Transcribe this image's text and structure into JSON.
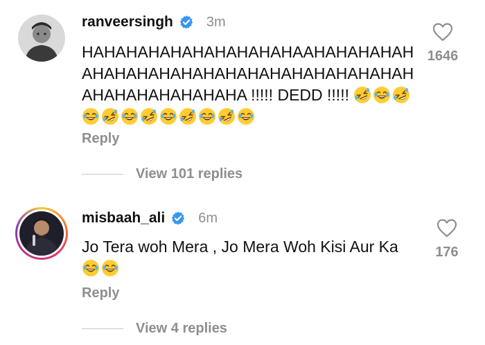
{
  "comments": [
    {
      "username": "ranveersingh",
      "verified": true,
      "time": "3m",
      "text": "HAHAHAHAHAHAHAHAHAHAAHAHAHAHAHAHAHAHAHAHAHAHAHAHAHAHAHAHAHAHAHAHAHAHAHAHAHA !!!!! DEDD !!!!!",
      "emojis": [
        "rolling-laugh",
        "grin-sweat-laugh",
        "rolling-laugh",
        "grin-sweat-laugh",
        "rolling-laugh",
        "grin-sweat-laugh",
        "rolling-laugh",
        "grin-sweat-laugh",
        "rolling-laugh",
        "grin-sweat-laugh",
        "rolling-laugh",
        "grin-sweat-laugh"
      ],
      "reply_label": "Reply",
      "view_replies_label": "View 101 replies",
      "like_count": "1646"
    },
    {
      "username": "misbaah_ali",
      "verified": true,
      "time": "6m",
      "text": "Jo Tera woh Mera , Jo Mera Woh Kisi Aur Ka",
      "emojis": [
        "grin-sweat-laugh",
        "grin-sweat-laugh"
      ],
      "reply_label": "Reply",
      "view_replies_label": "View 4 replies",
      "like_count": "176"
    }
  ],
  "colors": {
    "verified_blue": "#3897f0",
    "muted_text": "#8e8e8e",
    "emoji_yellow": "#ffcc33"
  }
}
